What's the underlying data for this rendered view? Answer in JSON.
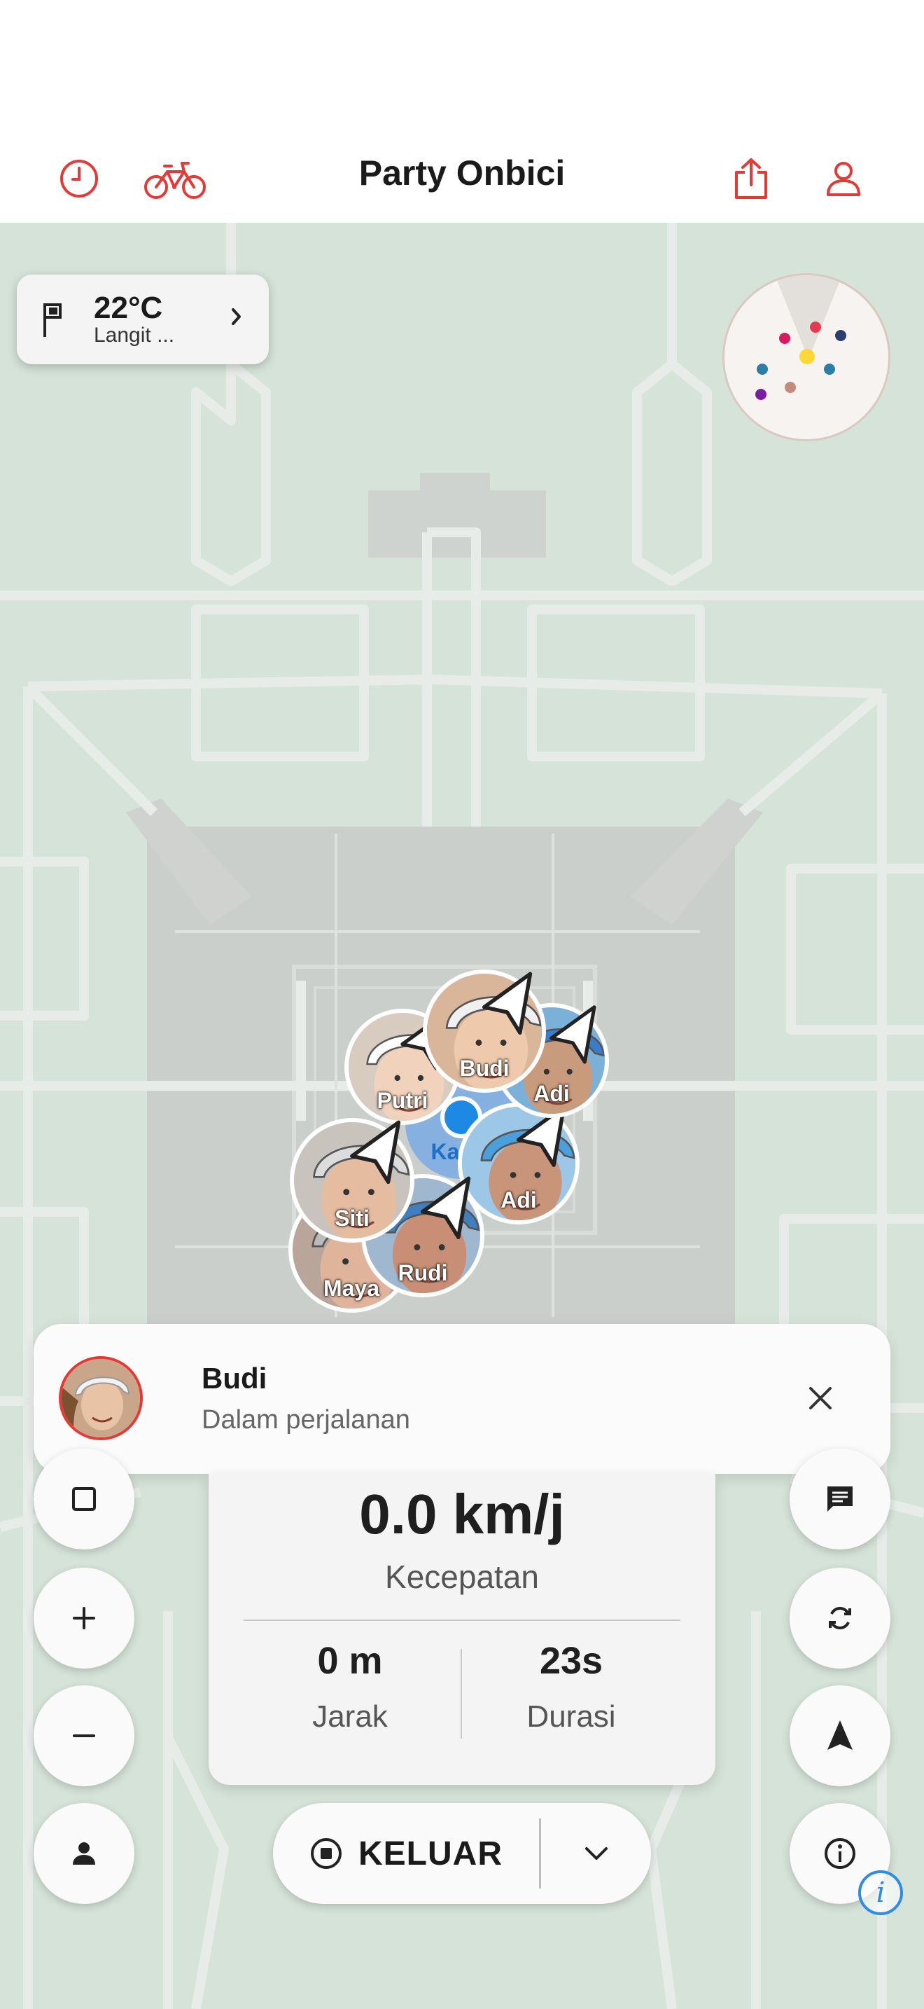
{
  "header": {
    "title": "Party Onbici",
    "icons": [
      "history-icon",
      "bike-icon",
      "share-icon",
      "profile-icon"
    ],
    "accent": "#e53935"
  },
  "weather": {
    "temperature": "22°C",
    "condition": "Langit ..."
  },
  "radar": {
    "dot_colors": [
      "#e53950",
      "#d81b60",
      "#2c3e70",
      "#fdd835",
      "#2e7da8",
      "#2e7da8",
      "#c48a7a",
      "#7b1fa2"
    ]
  },
  "riders": [
    {
      "name": "Budi"
    },
    {
      "name": "Adi"
    },
    {
      "name": "Putri"
    },
    {
      "name": "Kamu"
    },
    {
      "name": "Adi"
    },
    {
      "name": "Siti"
    },
    {
      "name": "Rudi"
    },
    {
      "name": "Maya"
    }
  ],
  "notification": {
    "name": "Budi",
    "status": "Dalam perjalanan"
  },
  "stats": {
    "speed": "0.0 km/j",
    "speed_label": "Kecepatan",
    "distance": "0 m",
    "distance_label": "Jarak",
    "duration": "23s",
    "duration_label": "Durasi"
  },
  "controls": {
    "exit_label": "KELUAR",
    "left_buttons": [
      "stop-square-icon",
      "zoom-in-icon",
      "zoom-out-icon",
      "person-icon"
    ],
    "right_buttons": [
      "chat-icon",
      "sync-icon",
      "navigate-arrow-icon",
      "info-icon"
    ],
    "attribution": "i"
  },
  "colors": {
    "map_bg": "#d5e3d8",
    "self_location": "#1e88e5"
  }
}
